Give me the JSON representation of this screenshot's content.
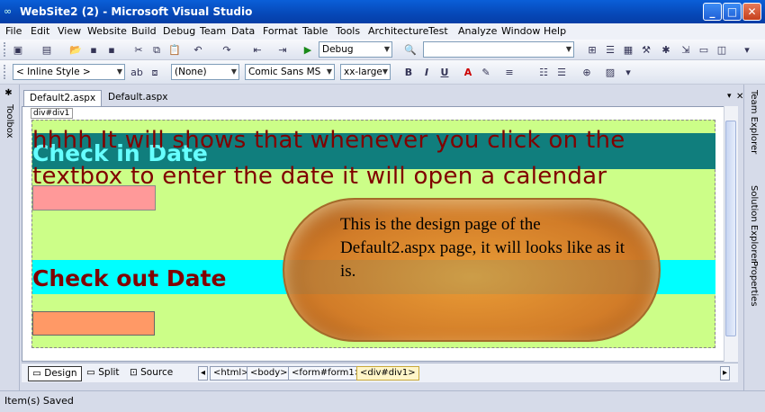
{
  "window": {
    "title": "WebSite2 (2) - Microsoft Visual Studio"
  },
  "menu": [
    "File",
    "Edit",
    "View",
    "Website",
    "Build",
    "Debug",
    "Team",
    "Data",
    "Format",
    "Table",
    "Tools",
    "Architecture",
    "Test",
    "Analyze",
    "Window",
    "Help"
  ],
  "toolbar": {
    "config": "Debug",
    "platform": ""
  },
  "formatting": {
    "style": "< Inline Style >",
    "block": "(None)",
    "font": "Comic Sans MS",
    "size": "xx-large"
  },
  "side": {
    "left": "Toolbox",
    "right": [
      "Team Explorer",
      "Solution Explorer",
      "Properties"
    ]
  },
  "tabs": [
    "Default2.aspx",
    "Default.aspx"
  ],
  "design": {
    "div_tag": "div#div1",
    "intro_line1": "hhhh It will shows that whenever you click on the",
    "intro_line2": "textbox to enter the date it will open a calendar",
    "checkin": "Check in Date",
    "checkout": "Check out Date"
  },
  "callout": "This is the design page of the Default2.aspx page, it will looks like as it is.",
  "view": {
    "design": "Design",
    "split": "Split",
    "source": "Source"
  },
  "breadcrumb": [
    "<html>",
    "<body>",
    "<form#form1>",
    "<div#div1>"
  ],
  "status": "Item(s) Saved"
}
